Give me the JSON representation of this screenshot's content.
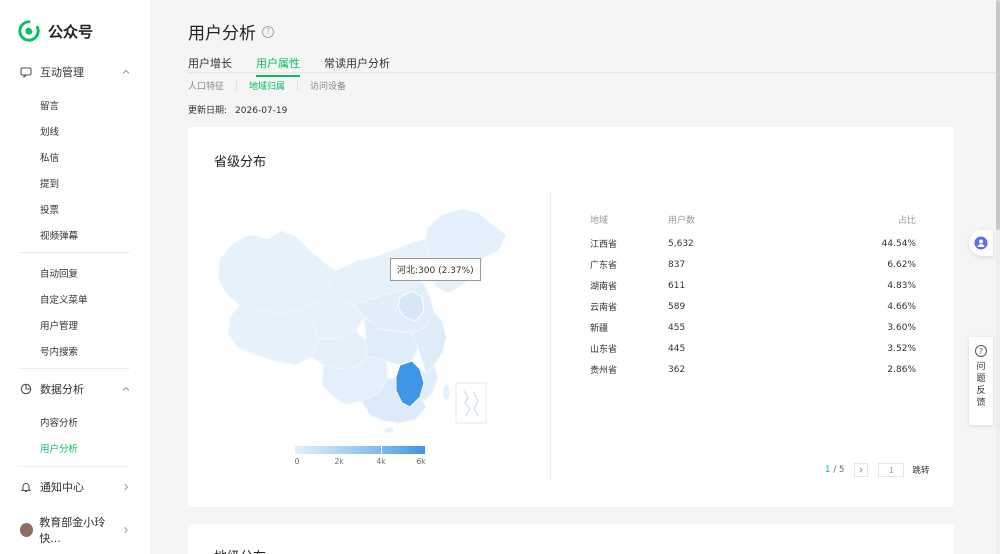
{
  "sidebar": {
    "logo_text": "公众号",
    "groups": [
      {
        "label": "互动管理",
        "items": [
          "留言",
          "划线",
          "私信",
          "提到",
          "投票",
          "视频弹幕"
        ]
      },
      {
        "label": "",
        "items": [
          "自动回复",
          "自定义菜单",
          "用户管理",
          "号内搜索"
        ]
      },
      {
        "label": "数据分析",
        "items": [
          "内容分析",
          "用户分析"
        ]
      }
    ],
    "notification": "通知中心",
    "account": "教育部金小玲快..."
  },
  "header": {
    "title": "用户分析",
    "tabs": [
      "用户增长",
      "用户属性",
      "常读用户分析"
    ],
    "subtabs": [
      "人口特征",
      "地域归属",
      "访问设备"
    ],
    "update_label": "更新日期:",
    "update_date": "2026-07-19"
  },
  "card": {
    "title": "省级分布",
    "tooltip": "河北:300 (2.37%)",
    "legend": {
      "min": 0,
      "max": 6000,
      "labels": [
        "0",
        "2k",
        "4k",
        "6k"
      ],
      "colors": [
        "#e3f0fb",
        "#3f95e6"
      ]
    },
    "table": {
      "headers": [
        "地域",
        "用户数",
        "占比"
      ],
      "rows": [
        [
          "江西省",
          "5,632",
          "44.54%"
        ],
        [
          "广东省",
          "837",
          "6.62%"
        ],
        [
          "湖南省",
          "611",
          "4.83%"
        ],
        [
          "云南省",
          "589",
          "4.66%"
        ],
        [
          "新疆",
          "455",
          "3.60%"
        ],
        [
          "山东省",
          "445",
          "3.52%"
        ],
        [
          "贵州省",
          "362",
          "2.86%"
        ]
      ]
    },
    "pager": {
      "current": "1",
      "total": "/ 5",
      "input": "1",
      "go_label": "跳转"
    }
  },
  "card2": {
    "title": "地级分布"
  },
  "feedback": {
    "chars": [
      "问",
      "题",
      "反",
      "馈"
    ]
  },
  "colors": {
    "accent": "#07c160",
    "map_highlight": "#3f95e6",
    "map_base": "#e3f0fb"
  }
}
